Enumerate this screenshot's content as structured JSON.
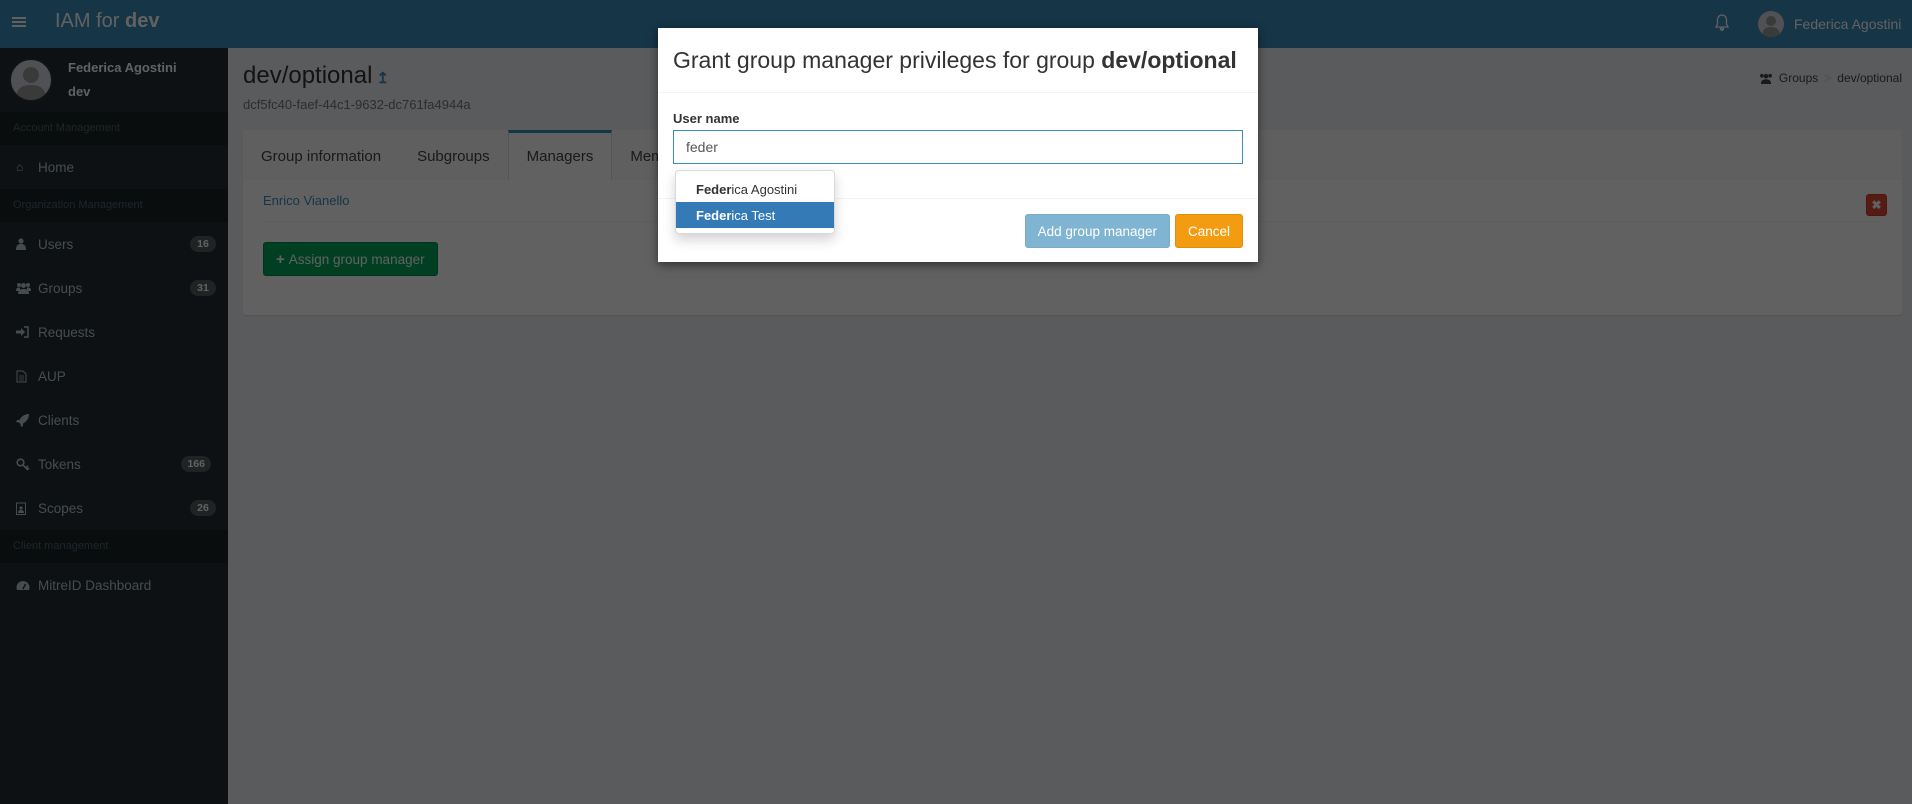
{
  "header": {
    "brand_prefix": "IAM for ",
    "brand_org": "dev",
    "user_name": "Federica Agostini"
  },
  "sidebar": {
    "user_name": "Federica Agostini",
    "user_org": "dev",
    "sections": [
      {
        "title": "Account Management"
      },
      {
        "title": "Organization Management"
      },
      {
        "title": "Client management"
      }
    ],
    "items": [
      {
        "label": "Home",
        "icon": "home-icon"
      },
      {
        "label": "Users",
        "icon": "user-icon",
        "badge": "16"
      },
      {
        "label": "Groups",
        "icon": "users-icon",
        "badge": "31"
      },
      {
        "label": "Requests",
        "icon": "sign-in-icon"
      },
      {
        "label": "AUP",
        "icon": "file-text-icon"
      },
      {
        "label": "Clients",
        "icon": "rocket-icon"
      },
      {
        "label": "Tokens",
        "icon": "key-icon",
        "badge": "166"
      },
      {
        "label": "Scopes",
        "icon": "id-badge-icon",
        "badge": "26"
      },
      {
        "label": "MitreID Dashboard",
        "icon": "dashboard-icon"
      }
    ]
  },
  "page": {
    "title": "dev/optional",
    "uuid": "dcf5fc40-faef-44c1-9632-dc761fa4944a",
    "breadcrumb": [
      "Groups",
      "dev/optional"
    ],
    "tabs": [
      "Group information",
      "Subgroups",
      "Managers",
      "Members"
    ],
    "active_tab": "Managers",
    "managers": [
      {
        "name": "Enrico Vianello"
      }
    ],
    "assign_button": "Assign group manager"
  },
  "modal": {
    "title_prefix": "Grant group manager privileges for group ",
    "title_group": "dev/optional",
    "field_label": "User name",
    "input_value": "feder",
    "suggestions": [
      {
        "match": "Feder",
        "rest": "ica Agostini",
        "active": false
      },
      {
        "match": "Feder",
        "rest": "ica Test",
        "active": true
      }
    ],
    "add_button": "Add group manager",
    "cancel_button": "Cancel"
  },
  "colors": {
    "primary": "#3c8dbc",
    "success": "#00a65a",
    "danger": "#dd4b39",
    "warning": "#f39c12",
    "sidebar_bg": "#222d32"
  }
}
